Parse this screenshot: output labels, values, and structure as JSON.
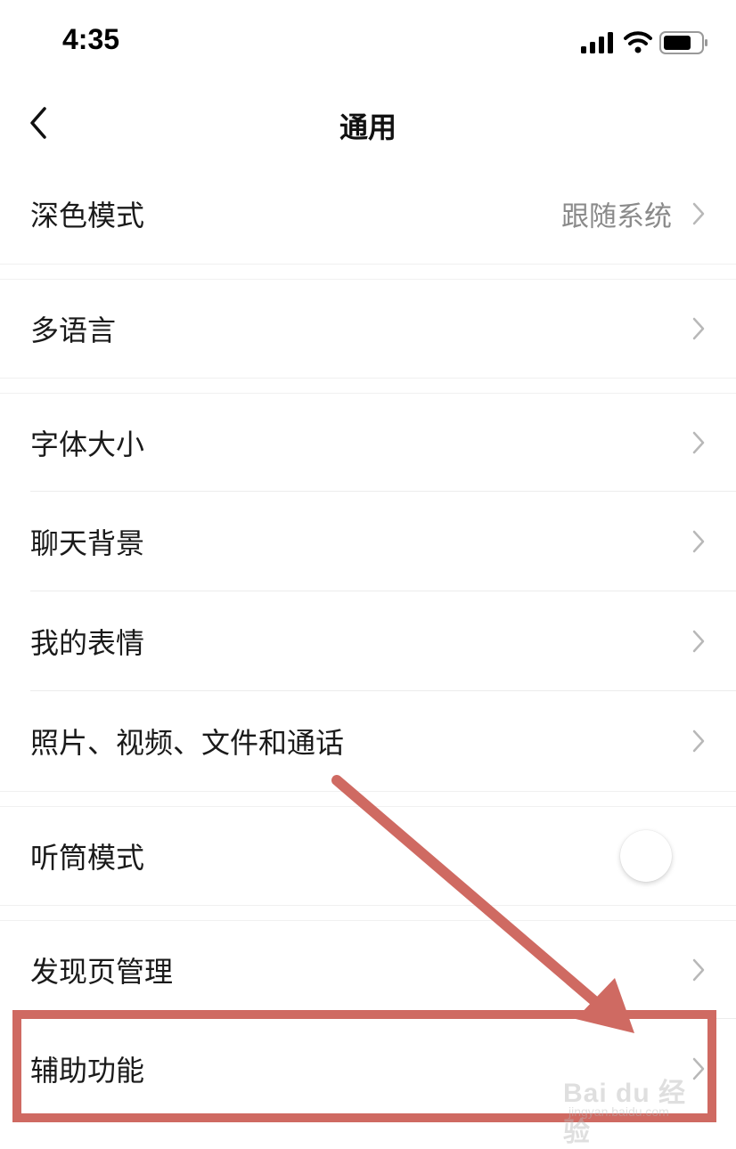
{
  "status_bar": {
    "time": "4:35"
  },
  "nav": {
    "title": "通用"
  },
  "rows": [
    {
      "label": "深色模式",
      "value": "跟随系统"
    },
    {
      "label": "多语言"
    },
    {
      "label": "字体大小"
    },
    {
      "label": "聊天背景"
    },
    {
      "label": "我的表情"
    },
    {
      "label": "照片、视频、文件和通话"
    },
    {
      "label": "听筒模式",
      "toggle_on": false
    },
    {
      "label": "发现页管理"
    },
    {
      "label": "辅助功能"
    }
  ],
  "annotation": {
    "highlight_color": "#cf6a62"
  },
  "watermark": {
    "text": "Bai du 经验",
    "sub": "jingyan.baidu.com"
  }
}
